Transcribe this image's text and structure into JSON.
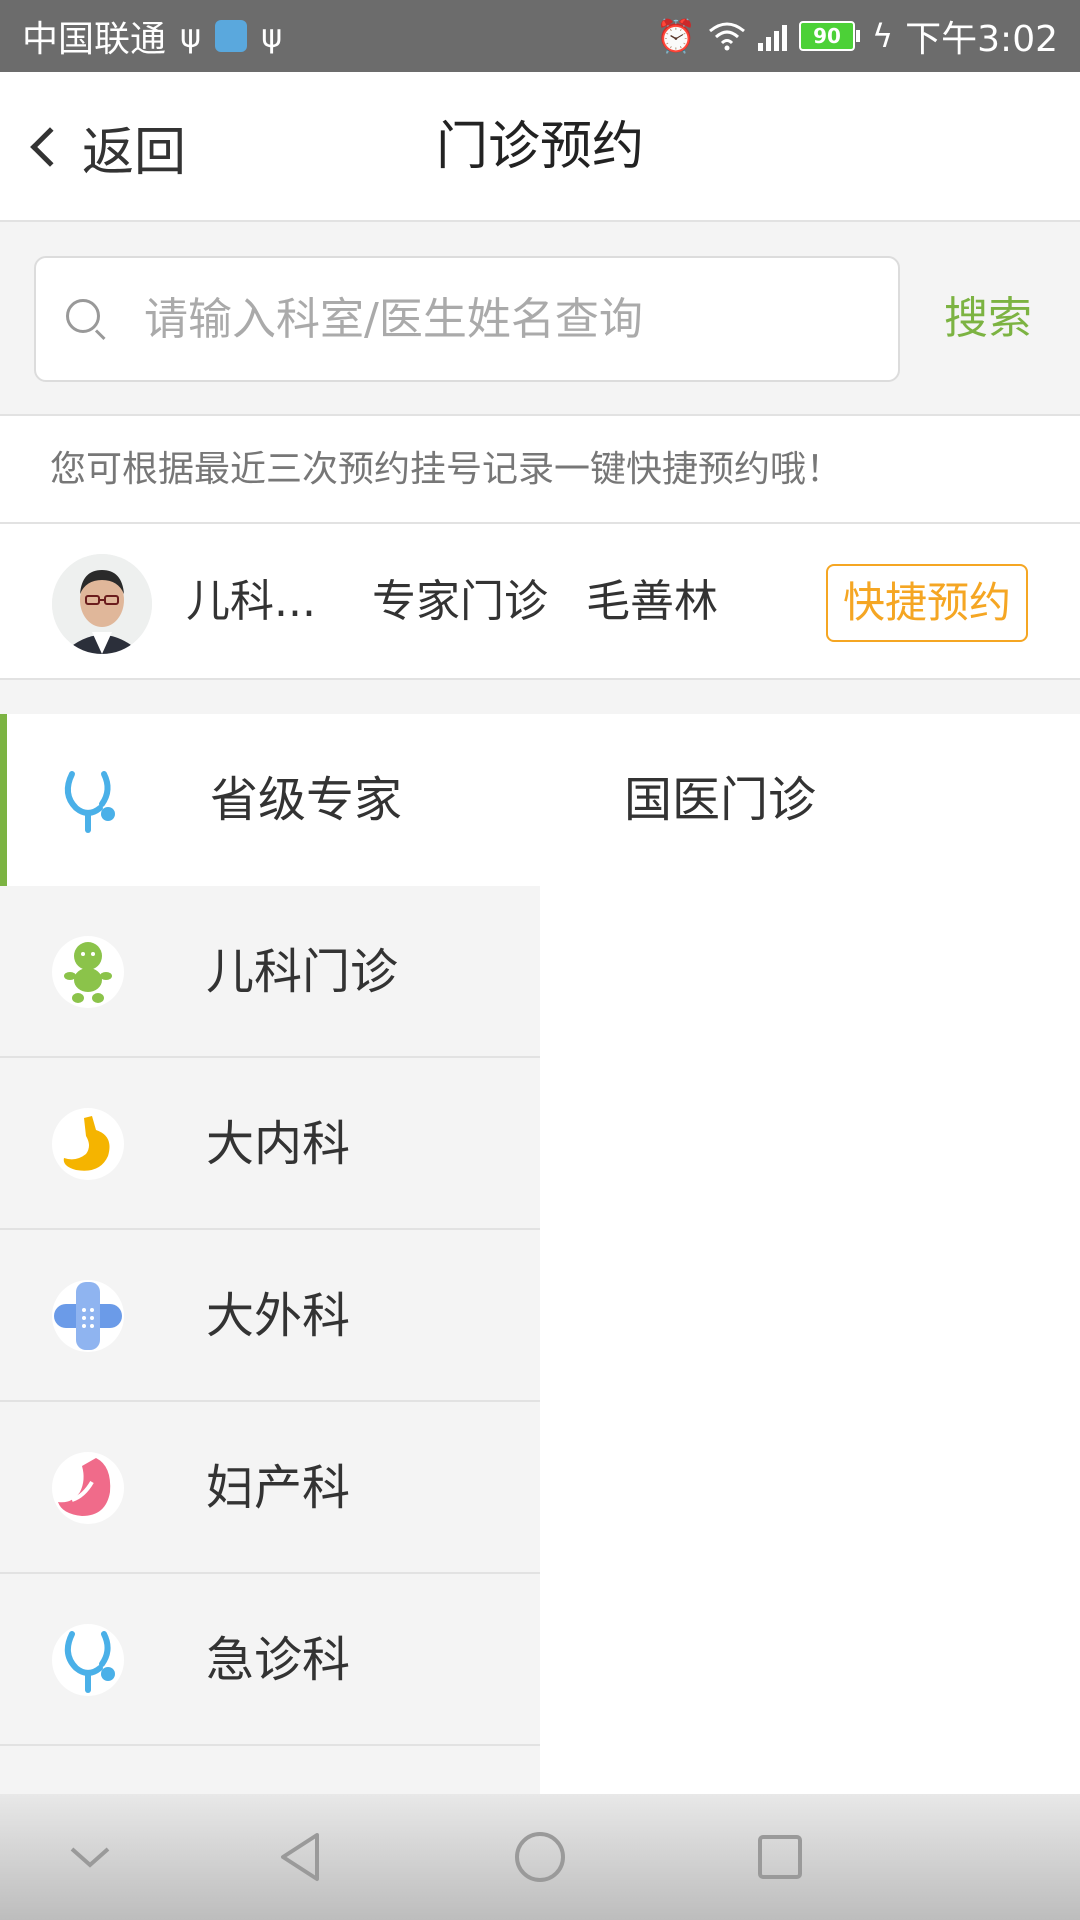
{
  "status_bar": {
    "carrier": "中国联通",
    "battery": "90",
    "time": "下午3:02"
  },
  "header": {
    "back_label": "返回",
    "title": "门诊预约"
  },
  "search": {
    "placeholder": "请输入科室/医生姓名查询",
    "button_label": "搜索"
  },
  "hint": "您可根据最近三次预约挂号记录一键快捷预约哦！",
  "quick": {
    "dept": "儿科...",
    "type": "专家门诊",
    "doctor": "毛善林",
    "button_label": "快捷预约"
  },
  "categories": [
    {
      "label": "省级专家",
      "icon": "stethoscope-icon",
      "color": "#4ab0e8"
    },
    {
      "label": "儿科门诊",
      "icon": "baby-icon",
      "color": "#8bc34a"
    },
    {
      "label": "大内科",
      "icon": "stomach-icon",
      "color": "#f5b400"
    },
    {
      "label": "大外科",
      "icon": "bandage-icon",
      "color": "#6b9be8"
    },
    {
      "label": "妇产科",
      "icon": "uterus-icon",
      "color": "#f06b8a"
    },
    {
      "label": "急诊科",
      "icon": "stethoscope-icon",
      "color": "#4ab0e8"
    }
  ],
  "sub_items": [
    "国医门诊"
  ],
  "colors": {
    "accent": "#7cb342",
    "quick_button": "#f5a623"
  }
}
